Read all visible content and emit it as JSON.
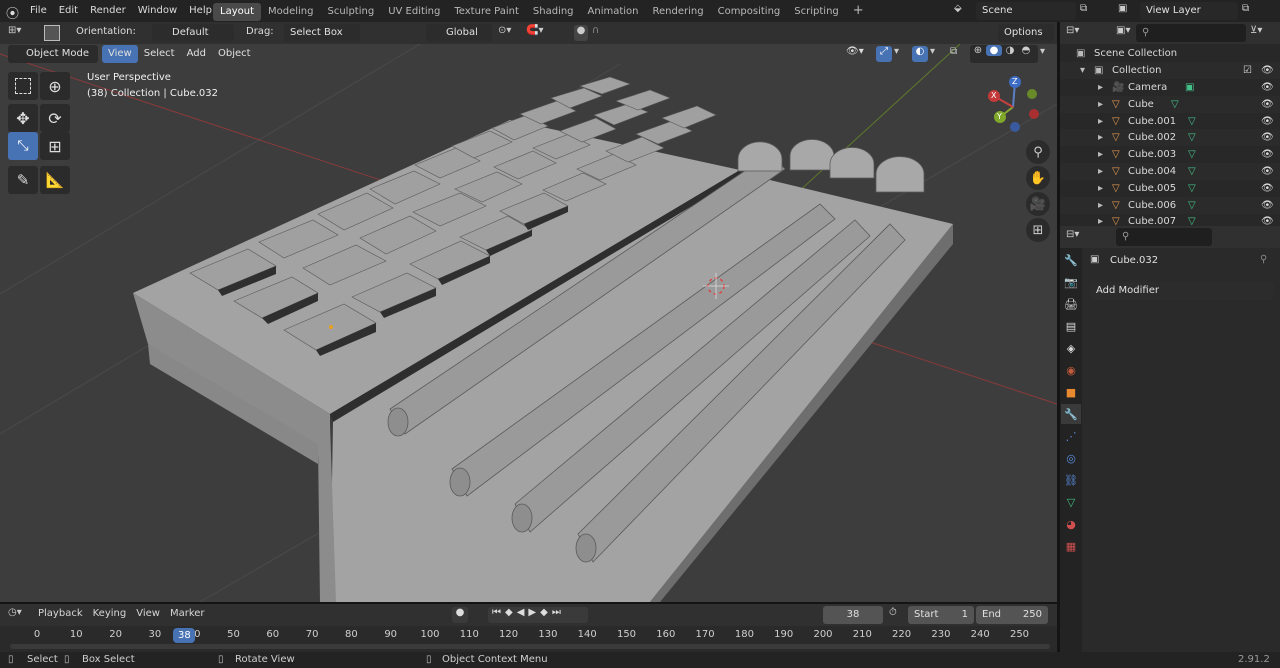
{
  "topbar": {
    "menus": [
      "File",
      "Edit",
      "Render",
      "Window",
      "Help"
    ],
    "workspaces": [
      "Layout",
      "Modeling",
      "Sculpting",
      "UV Editing",
      "Texture Paint",
      "Shading",
      "Animation",
      "Rendering",
      "Compositing",
      "Scripting"
    ],
    "add_tab": "+",
    "scene": "Scene",
    "view_layer": "View Layer"
  },
  "toolheader": {
    "orientation_label": "Orientation:",
    "orientation_value": "Default",
    "drag_label": "Drag:",
    "drag_value": "Select Box",
    "transform_value": "Global",
    "options": "Options"
  },
  "viewport_header": {
    "mode": "Object Mode",
    "menus": [
      "View",
      "Select",
      "Add",
      "Object"
    ]
  },
  "viewport": {
    "perspective": "User Perspective",
    "info": "(38) Collection | Cube.032",
    "axes": {
      "x": "X",
      "y": "Y",
      "z": "Z"
    }
  },
  "outliner": {
    "search_placeholder": "",
    "root": "Scene Collection",
    "collection": "Collection",
    "items": [
      "Camera",
      "Cube",
      "Cube.001",
      "Cube.002",
      "Cube.003",
      "Cube.004",
      "Cube.005",
      "Cube.006",
      "Cube.007"
    ]
  },
  "properties": {
    "object_name": "Cube.032",
    "add_modifier": "Add Modifier",
    "search_placeholder": ""
  },
  "timeline": {
    "menus": [
      "Playback",
      "Keying",
      "View",
      "Marker"
    ],
    "current_frame": "38",
    "start_label": "Start",
    "start_value": "1",
    "end_label": "End",
    "end_value": "250",
    "ticks": [
      "0",
      "10",
      "20",
      "30",
      "40",
      "50",
      "60",
      "70",
      "80",
      "90",
      "100",
      "110",
      "120",
      "130",
      "140",
      "150",
      "160",
      "170",
      "180",
      "190",
      "200",
      "210",
      "220",
      "230",
      "240",
      "250"
    ],
    "frame": 38
  },
  "status": {
    "select": "Select",
    "box_select": "Box Select",
    "rotate": "Rotate View",
    "context": "Object Context Menu",
    "version": "2.91.2"
  },
  "colors": {
    "accent": "#4772b3",
    "viewport": "#3d3d3d",
    "mesh": "#9a9a9a"
  }
}
